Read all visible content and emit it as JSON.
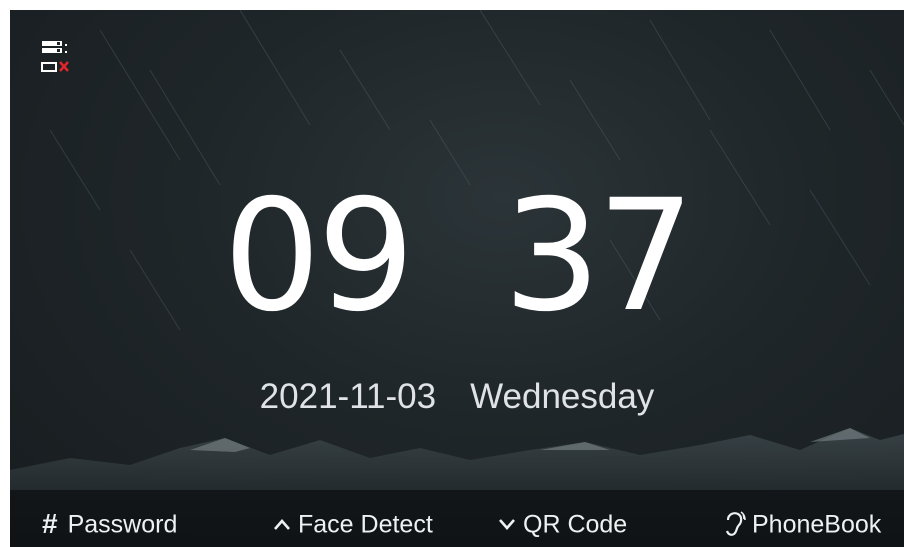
{
  "clock": {
    "hour": "09",
    "minute": "37"
  },
  "date": {
    "value": "2021-11-03",
    "weekday": "Wednesday"
  },
  "status": {
    "icon": "network-disconnected-icon",
    "alert_color": "#e0262b"
  },
  "bottom_bar": {
    "password": {
      "icon": "#",
      "label": "Password"
    },
    "face_detect": {
      "icon": "chevron-up-icon",
      "label": "Face Detect"
    },
    "qr_code": {
      "icon": "chevron-down-icon",
      "label": "QR Code"
    },
    "phonebook": {
      "icon": "ear-icon",
      "label": "PhoneBook"
    }
  }
}
